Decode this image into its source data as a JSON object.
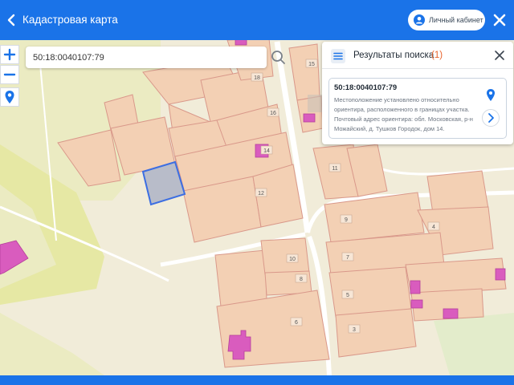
{
  "header": {
    "title": "Кадастровая карта",
    "cabinet_label": "Личный кабинет"
  },
  "search": {
    "value": "50:18:0040107:79"
  },
  "results": {
    "title": "Результаты поиска",
    "count": "(1)",
    "items": [
      {
        "number": "50:18:0040107:79",
        "description": "Местоположение установлено относительно ориентира, расположенного в границах участка. Почтовый адрес ориентира: обл. Московская, р-н Можайский, д. Тушков Городок, дом 14."
      }
    ]
  },
  "map": {
    "parcel_labels": [
      "18",
      "16",
      "14",
      "12",
      "15",
      "11",
      "9",
      "4",
      "7",
      "5",
      "3",
      "10",
      "8",
      "6"
    ]
  },
  "colors": {
    "accent": "#1a73e8",
    "parcel_fill": "#f3d0b4",
    "parcel_stroke": "#d9988a",
    "building": "#d95cbe",
    "selected": "#3c6ee2",
    "count": "#e8632b"
  }
}
